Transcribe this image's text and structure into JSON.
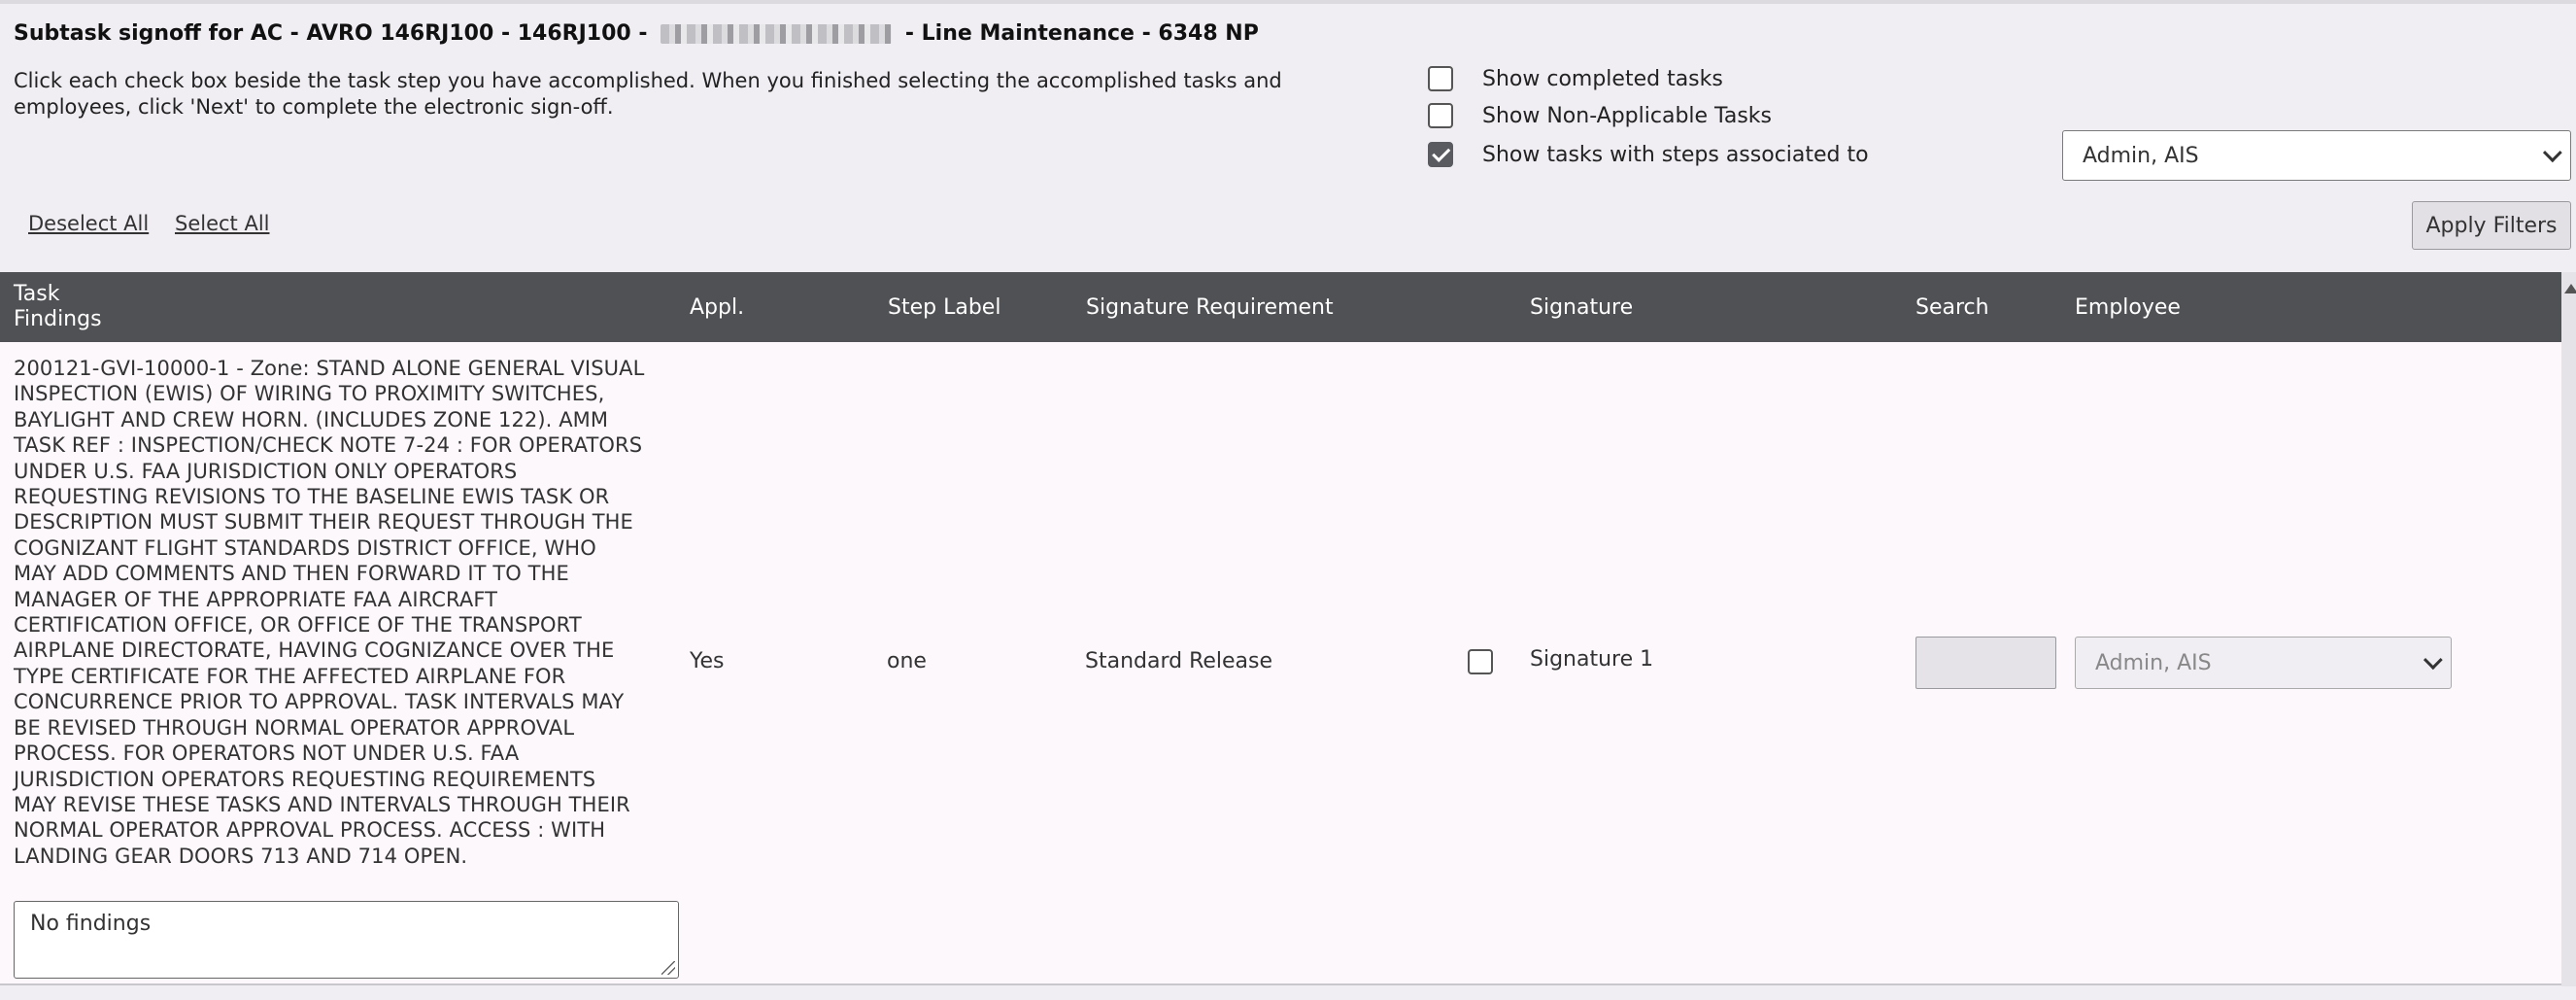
{
  "header": {
    "title_prefix": "Subtask signoff for AC - AVRO 146RJ100 - 146RJ100 -",
    "title_suffix": "- Line Maintenance - 6348 NP"
  },
  "instructions": "Click each check box beside the task step you have accomplished. When you finished selecting the accomplished tasks and employees, click 'Next' to complete the electronic sign-off.",
  "filters": {
    "show_completed": {
      "label": "Show completed tasks",
      "checked": false
    },
    "show_non_applicable": {
      "label": "Show Non-Applicable Tasks",
      "checked": false
    },
    "show_associated": {
      "label": "Show tasks with steps associated to",
      "checked": true
    },
    "associated_selected": "Admin, AIS"
  },
  "actions": {
    "deselect_all": "Deselect All",
    "select_all": "Select All",
    "apply_filters": "Apply Filters"
  },
  "table": {
    "headers": {
      "task_line1": "Task",
      "task_line2": "Findings",
      "appl": "Appl.",
      "step_label": "Step Label",
      "signature_requirement": "Signature Requirement",
      "signature": "Signature",
      "search": "Search",
      "employee": "Employee"
    },
    "rows": [
      {
        "task_lines": [
          "200121-GVI-10000-1 - Zone: STAND ALONE GENERAL VISUAL",
          "INSPECTION (EWIS) OF WIRING TO PROXIMITY SWITCHES,",
          "BAYLIGHT AND CREW HORN. (INCLUDES ZONE 122). AMM",
          "TASK REF : INSPECTION/CHECK NOTE 7-24 : FOR OPERATORS",
          "UNDER U.S. FAA JURISDICTION ONLY OPERATORS",
          "REQUESTING REVISIONS TO THE BASELINE EWIS TASK OR",
          "DESCRIPTION MUST SUBMIT THEIR REQUEST THROUGH THE",
          "COGNIZANT FLIGHT STANDARDS DISTRICT OFFICE, WHO",
          "MAY ADD COMMENTS AND THEN FORWARD IT TO THE",
          "MANAGER OF THE APPROPRIATE FAA AIRCRAFT",
          "CERTIFICATION OFFICE, OR OFFICE OF THE TRANSPORT",
          "AIRPLANE DIRECTORATE, HAVING COGNIZANCE OVER THE",
          "TYPE CERTIFICATE FOR THE AFFECTED AIRPLANE FOR",
          "CONCURRENCE PRIOR TO APPROVAL. TASK INTERVALS MAY",
          "BE REVISED THROUGH NORMAL OPERATOR APPROVAL",
          "PROCESS. FOR OPERATORS NOT UNDER U.S. FAA",
          "JURISDICTION OPERATORS REQUESTING REQUIREMENTS",
          "MAY REVISE THESE TASKS AND INTERVALS THROUGH THEIR",
          "NORMAL OPERATOR APPROVAL PROCESS. ACCESS : WITH",
          "LANDING GEAR DOORS 713 AND 714 OPEN."
        ],
        "findings": "No findings",
        "appl": "Yes",
        "step_label": "one",
        "signature_requirement": "Standard Release",
        "signature_checked": false,
        "signature": "Signature 1",
        "search": "",
        "employee": "Admin, AIS"
      }
    ]
  }
}
